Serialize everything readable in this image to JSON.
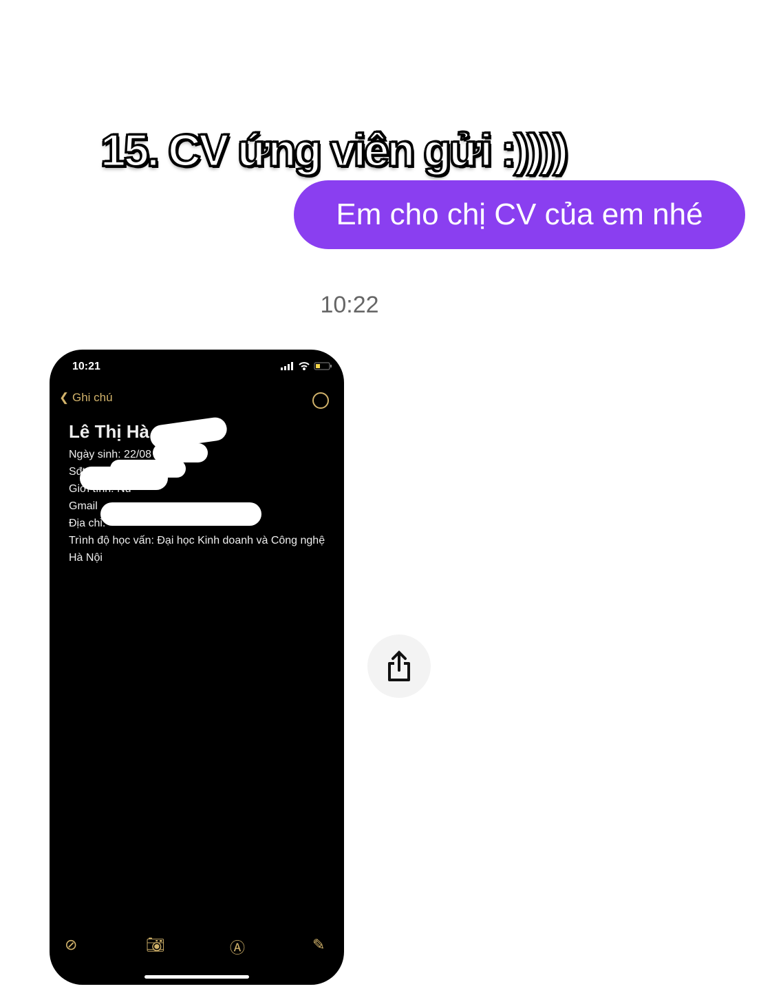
{
  "caption": "15. CV ứng viên gửi :))))",
  "message": {
    "text": "Em cho chị CV của em nhé",
    "color": "#8a3ff0"
  },
  "timestamp": "10:22",
  "screenshot": {
    "status_time": "10:21",
    "back_label": "Ghi chú",
    "note": {
      "title": "Lê Thị Hà",
      "lines": [
        "Ngày sinh: 22/08",
        "Sđt: 09",
        "Giới tính: Nữ",
        "Gmail",
        "Địa chỉ: ",
        "Trình độ học vấn: Đại học Kinh doanh và Công nghệ Hà Nội"
      ]
    },
    "accent": "#d2b36b"
  },
  "icons": [
    "chevron-left-icon",
    "more-icon",
    "checklist-icon",
    "camera-icon",
    "markup-icon",
    "compose-icon",
    "share-icon"
  ]
}
